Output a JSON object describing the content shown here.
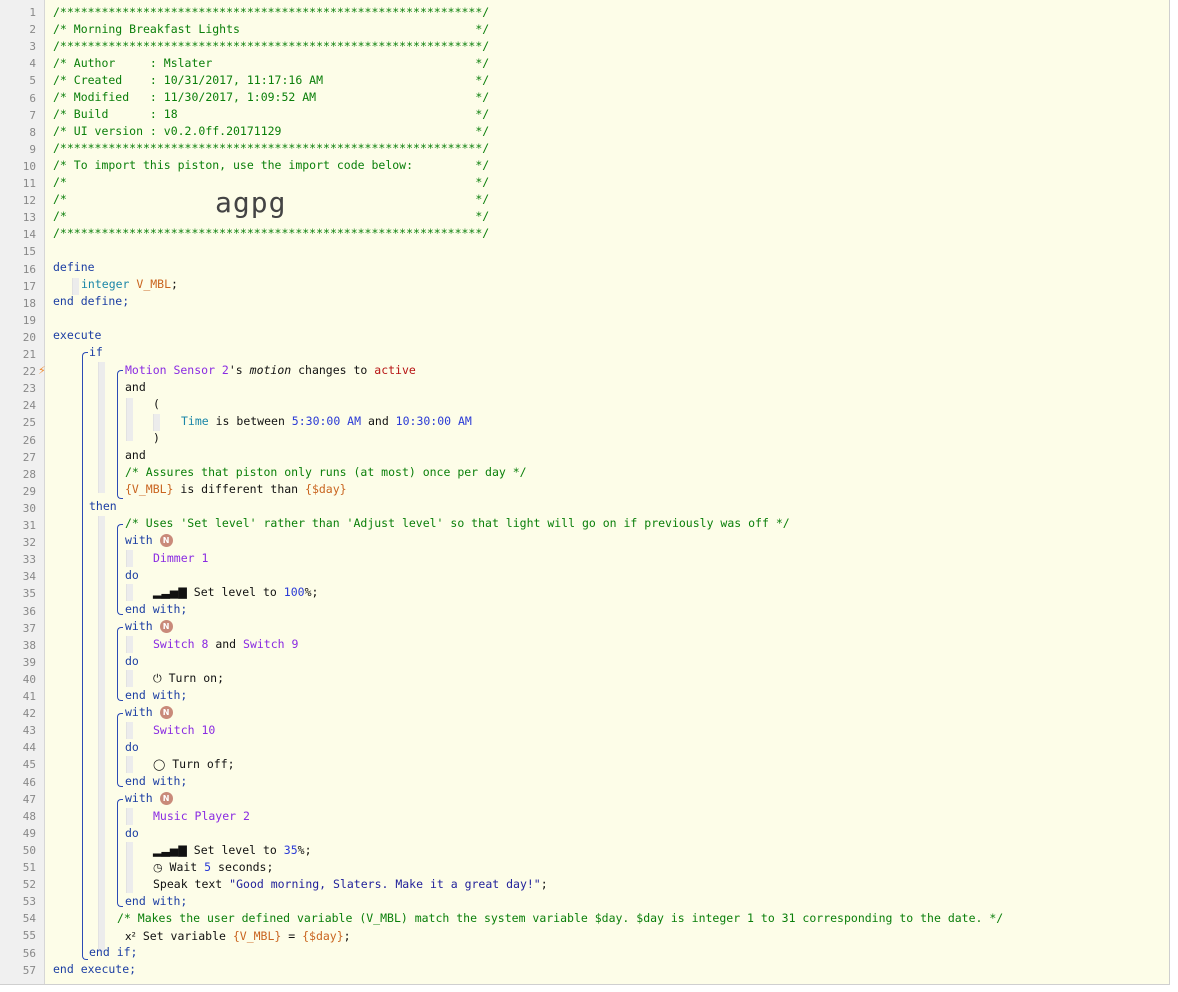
{
  "lines": {
    "l1": "/*************************************************************/",
    "l2": "/* Morning Breakfast Lights                                  */",
    "l3": "/*************************************************************/",
    "l4": "/* Author     : Mslater                                      */",
    "l5": "/* Created    : 10/31/2017, 11:17:16 AM                      */",
    "l6": "/* Modified   : 11/30/2017, 1:09:52 AM                       */",
    "l7": "/* Build      : 18                                           */",
    "l8": "/* UI version : v0.2.0ff.20171129                            */",
    "l9": "/*************************************************************/",
    "l10": "/* To import this piston, use the import code below:         */",
    "l11": "/*                                                           */",
    "l12": "/*                                                           */",
    "l13": "/*                                                           */",
    "l14": "/*************************************************************/",
    "l16": "define",
    "l17_type": "integer",
    "l17_var": "V_MBL",
    "l17_end": ";",
    "l18": "end define;",
    "l20": "execute",
    "l21": "if",
    "l22_dev": "Motion Sensor 2",
    "l22_apos": "'s ",
    "l22_attr": "motion",
    "l22_op": " changes to ",
    "l22_val": "active",
    "l23": "and",
    "l24": "(",
    "l25_time": "Time",
    "l25_op": " is between ",
    "l25_t1": "5:30:00 AM",
    "l25_and": " and ",
    "l25_t2": "10:30:00 AM",
    "l26": ")",
    "l27": "and",
    "l28": "/* Assures that piston only runs (at most) once per day */",
    "l29_v1": "{V_MBL}",
    "l29_op": " is different than ",
    "l29_v2": "{$day}",
    "l30": "then",
    "l31": "/* Uses 'Set level' rather than 'Adjust level' so that light will go on if previously was off */",
    "with": "with",
    "do": "do",
    "endwith": "end with;",
    "badge": "N",
    "l33": "Dimmer 1",
    "l35_a": " Set level to ",
    "l35_n": "100",
    "l35_b": "%;",
    "l38_d1": "Switch 8",
    "l38_and": " and ",
    "l38_d2": "Switch 9",
    "l40": " Turn on;",
    "l43": "Switch 10",
    "l45": " Turn off;",
    "l48": "Music Player 2",
    "l50_a": " Set level to ",
    "l50_n": "35",
    "l50_b": "%;",
    "l51_a": " Wait ",
    "l51_n": "5",
    "l51_b": " seconds;",
    "l52_a": "Speak text ",
    "l52_s": "\"Good morning, Slaters. Make it a great day!\"",
    "l52_b": ";",
    "l54": "/* Makes the user defined variable (V_MBL) match the system variable $day. $day is integer 1 to 31 corresponding to the date. */",
    "l55_a": " Set variable ",
    "l55_v1": "{V_MBL}",
    "l55_eq": " = ",
    "l55_v2": "{$day}",
    "l55_b": ";",
    "l56": "end if;",
    "l57": "end execute;"
  },
  "import_code": "agpg",
  "line_numbers": [
    "1",
    "2",
    "3",
    "4",
    "5",
    "6",
    "7",
    "8",
    "9",
    "10",
    "11",
    "12",
    "13",
    "14",
    "15",
    "16",
    "17",
    "18",
    "19",
    "20",
    "21",
    "22",
    "23",
    "24",
    "25",
    "26",
    "27",
    "28",
    "29",
    "30",
    "31",
    "32",
    "33",
    "34",
    "35",
    "36",
    "37",
    "38",
    "39",
    "40",
    "41",
    "42",
    "43",
    "44",
    "45",
    "46",
    "47",
    "48",
    "49",
    "50",
    "51",
    "52",
    "53",
    "54",
    "55",
    "56",
    "57"
  ]
}
